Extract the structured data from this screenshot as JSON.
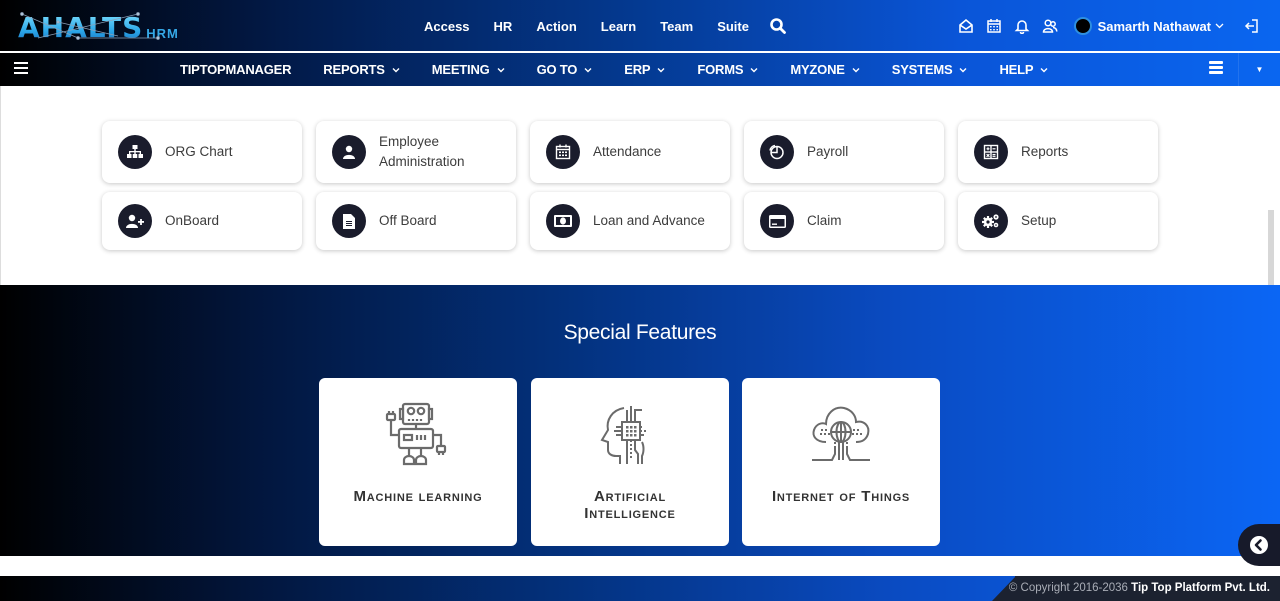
{
  "header": {
    "logo_main": "AHALTS",
    "logo_sub": "HRM",
    "nav": [
      "Access",
      "HR",
      "Action",
      "Learn",
      "Team",
      "Suite"
    ],
    "search_icon": "search-icon",
    "right_icons": [
      "inbox-icon",
      "calendar-icon",
      "bell-icon",
      "users-icon"
    ],
    "user_name": "Samarth Nathawat",
    "logout_icon": "logout-icon"
  },
  "menu": {
    "items": [
      {
        "label": "TIPTOPMANAGER",
        "has_dropdown": false
      },
      {
        "label": "REPORTS",
        "has_dropdown": true
      },
      {
        "label": "MEETING",
        "has_dropdown": true
      },
      {
        "label": "GO TO",
        "has_dropdown": true
      },
      {
        "label": "ERP",
        "has_dropdown": true
      },
      {
        "label": "FORMS",
        "has_dropdown": true
      },
      {
        "label": "MYZONE",
        "has_dropdown": true
      },
      {
        "label": "SYSTEMS",
        "has_dropdown": true
      },
      {
        "label": "HELP",
        "has_dropdown": true
      }
    ]
  },
  "tiles": [
    {
      "label": "ORG Chart",
      "icon": "org-chart-icon"
    },
    {
      "label": "Employee Administration",
      "icon": "user-icon"
    },
    {
      "label": "Attendance",
      "icon": "calendar-icon"
    },
    {
      "label": "Payroll",
      "icon": "pie-chart-icon"
    },
    {
      "label": "Reports",
      "icon": "calculator-icon"
    },
    {
      "label": "OnBoard",
      "icon": "user-plus-icon"
    },
    {
      "label": "Off Board",
      "icon": "document-icon"
    },
    {
      "label": "Loan and Advance",
      "icon": "money-icon"
    },
    {
      "label": "Claim",
      "icon": "credit-card-icon"
    },
    {
      "label": "Setup",
      "icon": "cogs-icon"
    }
  ],
  "features": {
    "title": "Special Features",
    "cards": [
      {
        "line1": "Machine learning",
        "line2": "",
        "icon": "robot-icon"
      },
      {
        "line1": "Artificial",
        "line2": "Intelligence",
        "icon": "ai-head-chip-icon"
      },
      {
        "line1": "Internet of Things",
        "line2": "",
        "icon": "cloud-globe-icon"
      }
    ]
  },
  "footer": {
    "copyright": "© Copyright 2016-2036 ",
    "company": "Tip Top Platform Pvt. Ltd."
  }
}
